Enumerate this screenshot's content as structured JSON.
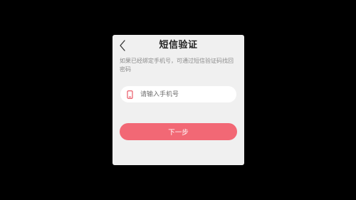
{
  "dialog": {
    "title": "短信验证",
    "hint": "如果已经绑定手机号，可通过短信验证码找回密码",
    "back_icon": "chevron-left-icon",
    "phone_field": {
      "icon": "phone-icon",
      "placeholder": "请输入手机号",
      "value": ""
    },
    "next_button_label": "下一步"
  },
  "colors": {
    "background": "#000000",
    "dialog_bg": "#f0f0f0",
    "accent": "#f26875",
    "phone_icon": "#e84b5a"
  }
}
